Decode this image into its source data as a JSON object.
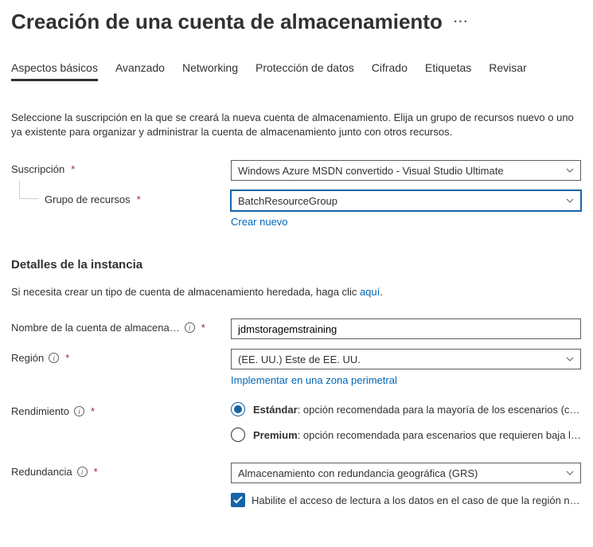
{
  "title": "Creación de una cuenta de almacenamiento",
  "tabs": {
    "basic": "Aspectos básicos",
    "advanced": "Avanzado",
    "networking": "Networking",
    "data_protection": "Protección de datos",
    "encryption": "Cifrado",
    "tags": "Etiquetas",
    "review": "Revisar"
  },
  "intro": "Seleccione la suscripción en la que se creará la nueva cuenta de almacenamiento. Elija un grupo de recursos nuevo o uno ya existente para organizar y administrar la cuenta de almacenamiento junto con otros recursos.",
  "subscription": {
    "label": "Suscripción",
    "value": "Windows Azure MSDN convertido - Visual Studio Ultimate"
  },
  "resource_group": {
    "label": "Grupo de recursos",
    "value": "BatchResourceGroup",
    "create_new": "Crear nuevo"
  },
  "instance": {
    "header": "Detalles de la instancia",
    "legacy_hint_prefix": "Si necesita crear un tipo de cuenta de almacenamiento heredada, haga clic ",
    "legacy_hint_link": "aquí",
    "name_label": "Nombre de la cuenta de almacena…",
    "name_value": "jdmstoragemstraining",
    "region_label": "Región",
    "region_value": "(EE. UU.) Este de EE. UU.",
    "region_link": "Implementar en una zona perimetral",
    "performance_label": "Rendimiento",
    "perf_standard_bold": "Estándar",
    "perf_standard_rest": ": opción recomendada para la mayoría de los escenarios (cuenta de …",
    "perf_premium_bold": "Premium",
    "perf_premium_rest": ": opción recomendada para escenarios que requieren baja latencia.",
    "redundancy_label": "Redundancia",
    "redundancy_value": "Almacenamiento con redundancia geográfica (GRS)",
    "redundancy_checkbox": "Habilite el acceso de lectura a los datos en el caso de que la región no esté …"
  }
}
